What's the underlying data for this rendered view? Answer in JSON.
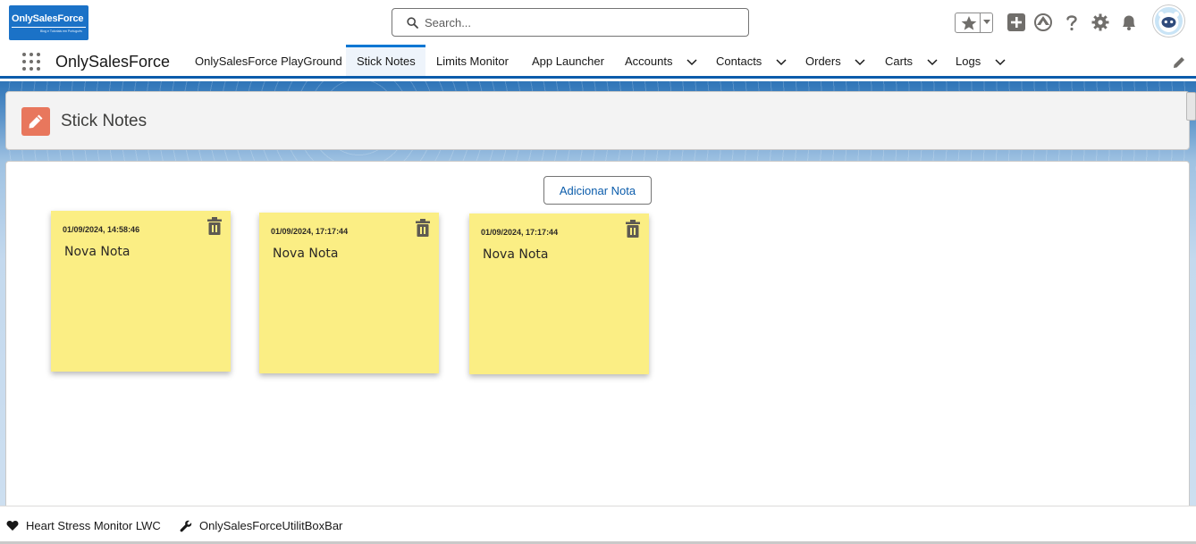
{
  "header": {
    "logo_text": "OnlySalesForce",
    "logo_subtext": "Blog e Tutoriais em Português",
    "search_placeholder": "Search...",
    "icons": [
      "star-icon",
      "chevron-down-icon",
      "plus-icon",
      "trailhead-icon",
      "help-icon",
      "gear-icon",
      "bell-icon",
      "avatar"
    ]
  },
  "nav": {
    "app_name": "OnlySalesForce",
    "tabs": [
      {
        "label": "OnlySalesForce PlayGround",
        "dropdown": false,
        "active": false
      },
      {
        "label": "Stick Notes",
        "dropdown": false,
        "active": true
      },
      {
        "label": "Limits Monitor",
        "dropdown": false,
        "active": false
      },
      {
        "label": "App Launcher",
        "dropdown": false,
        "active": false
      },
      {
        "label": "Accounts",
        "dropdown": true,
        "active": false
      },
      {
        "label": "Contacts",
        "dropdown": true,
        "active": false
      },
      {
        "label": "Orders",
        "dropdown": true,
        "active": false
      },
      {
        "label": "Carts",
        "dropdown": true,
        "active": false
      },
      {
        "label": "Logs",
        "dropdown": true,
        "active": false
      }
    ]
  },
  "page": {
    "title": "Stick Notes",
    "add_button_label": "Adicionar Nota",
    "notes": [
      {
        "timestamp": "01/09/2024, 14:58:46",
        "text": "Nova Nota"
      },
      {
        "timestamp": "01/09/2024, 17:17:44",
        "text": "Nova Nota"
      },
      {
        "timestamp": "01/09/2024, 17:17:44",
        "text": "Nova Nota"
      }
    ]
  },
  "utility_bar": {
    "items": [
      {
        "label": "Heart Stress Monitor LWC",
        "icon": "heart-icon"
      },
      {
        "label": "OnlySalesForceUtilitBoxBar",
        "icon": "wrench-icon"
      }
    ]
  },
  "colors": {
    "brand": "#0176d3",
    "note_yellow": "#fbee84",
    "page_icon": "#e8775d"
  }
}
